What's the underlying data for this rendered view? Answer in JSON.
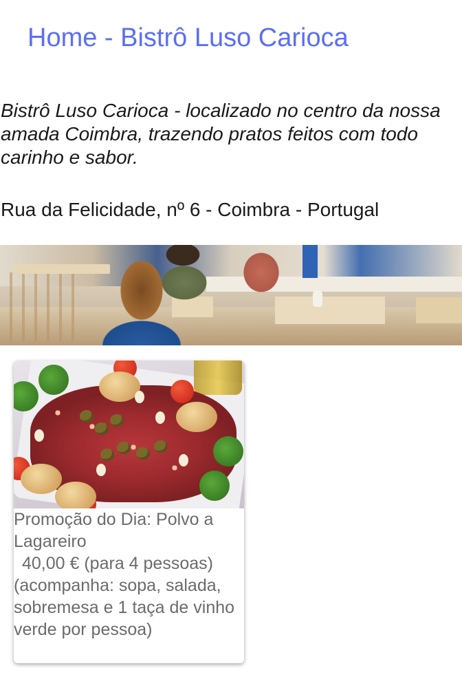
{
  "header": {
    "title": "Home - Bistrô Luso Carioca"
  },
  "intro": {
    "tagline": "Bistrô Luso Carioca - localizado no centro da nossa amada Coimbra, trazendo pratos feitos com todo carinho e sabor.",
    "address": "Rua da Felicidade, nº 6 - Coimbra - Portugal"
  },
  "banner": {
    "image": "restaurant-interior-photo"
  },
  "promo": {
    "image": "polvo-a-lagareiro-photo",
    "title": "Promoção do Dia: Polvo a Lagareiro",
    "price": "40,00 € (para 4 pessoas)",
    "description": "(acompanha: sopa, salada, sobremesa e 1 taça de vinho verde por pessoa)"
  },
  "colors": {
    "title": "#5b6ef5",
    "body_text": "#1a1a1a",
    "card_text": "#6b6b6b"
  }
}
